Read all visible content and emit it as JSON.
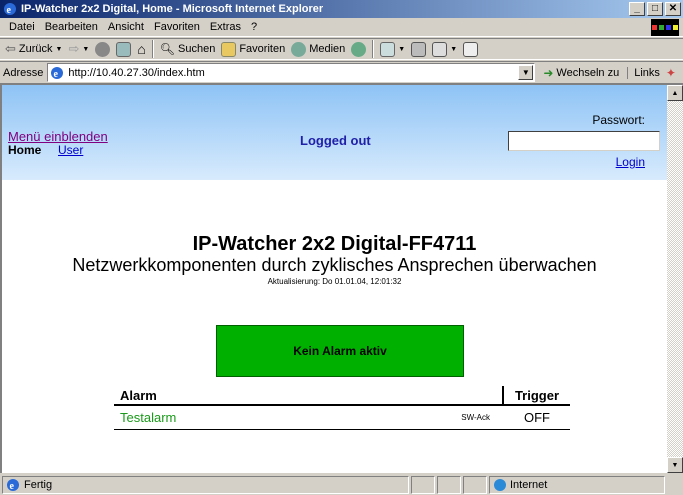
{
  "window": {
    "title": "IP-Watcher 2x2 Digital, Home - Microsoft Internet Explorer"
  },
  "menubar": {
    "items": [
      "Datei",
      "Bearbeiten",
      "Ansicht",
      "Favoriten",
      "Extras",
      "?"
    ]
  },
  "toolbar": {
    "back": "Zurück",
    "search": "Suchen",
    "favorites": "Favoriten",
    "media": "Medien"
  },
  "address": {
    "label": "Adresse",
    "url": "http://10.40.27.30/index.htm",
    "go": "Wechseln zu",
    "links": "Links"
  },
  "page": {
    "menu_link": "Menü einblenden",
    "home": "Home",
    "user": "User",
    "status": "Logged out",
    "password_label": "Passwort:",
    "login": "Login",
    "device_title": "IP-Watcher 2x2 Digital-FF4711",
    "device_subtitle": "Netzwerkkomponenten durch zyklisches Ansprechen überwachen",
    "update_line": "Aktualisierung:  Do 01.01.04, 12:01:32",
    "alarm_status": "Kein Alarm aktiv",
    "table": {
      "col_alarm": "Alarm",
      "col_trigger": "Trigger",
      "rows": [
        {
          "name": "Testalarm",
          "ack": "SW-Ack",
          "state": "OFF"
        }
      ]
    }
  },
  "statusbar": {
    "left": "Fertig",
    "zone": "Internet"
  }
}
